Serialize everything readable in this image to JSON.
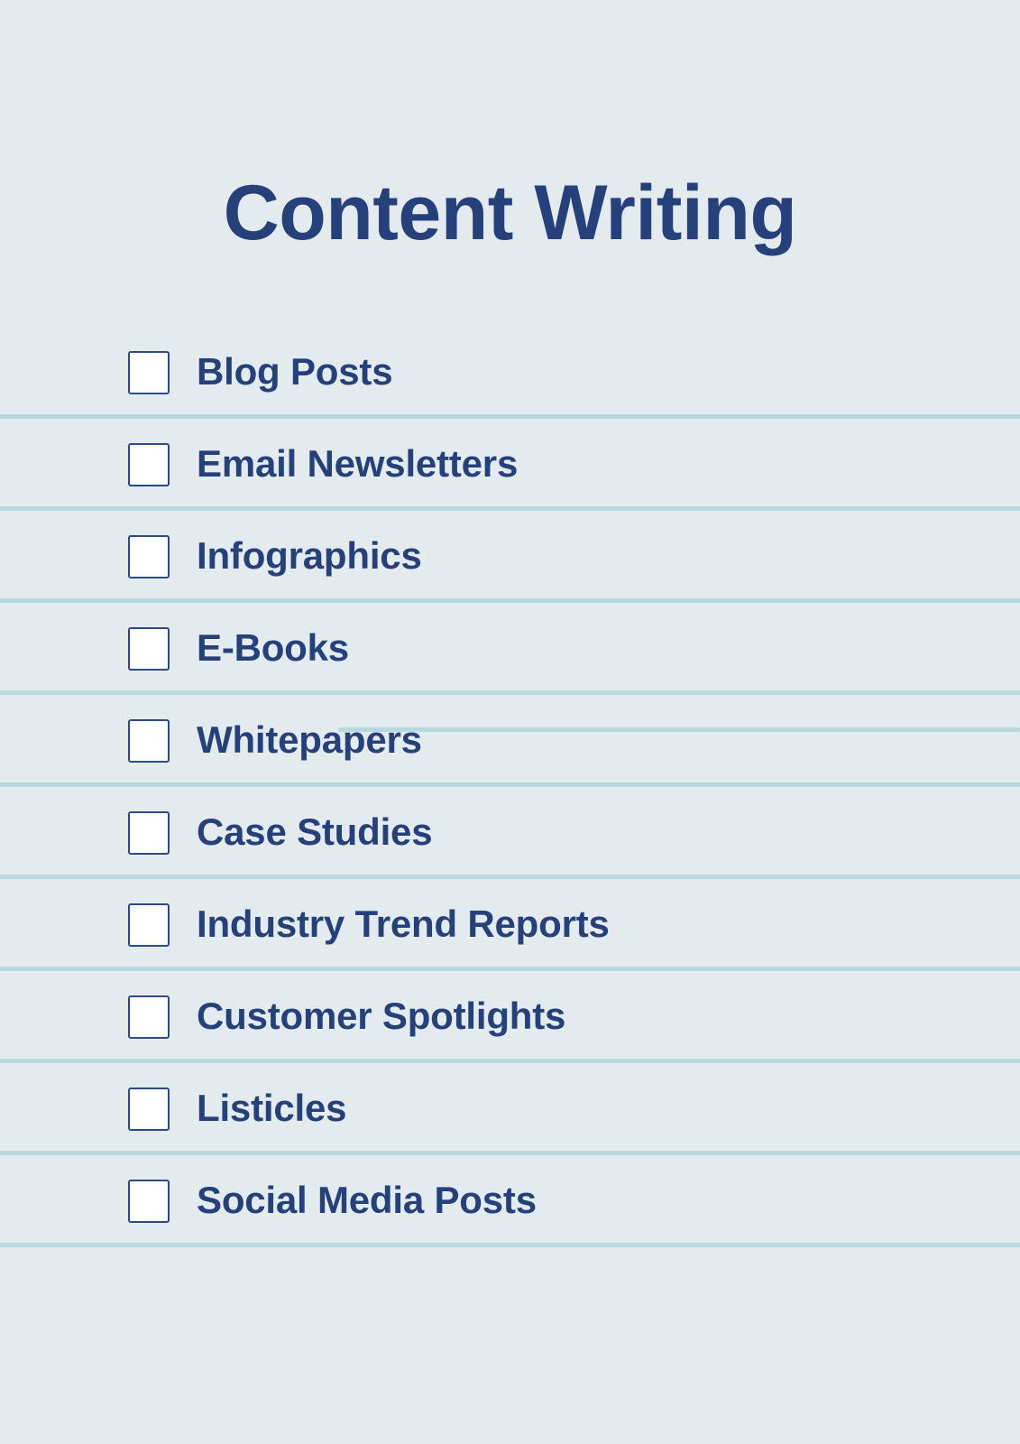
{
  "document": {
    "title": "Content Writing",
    "type": "checklist",
    "background_color": "#e4ebee",
    "accent_color": "#25407a",
    "divider_color": "#b9d8e0",
    "checkbox_fill_color": "#ffffff",
    "checkbox_border_color": "#2c4a8a"
  },
  "checklist": {
    "items": [
      {
        "label": "Blog Posts",
        "checked": false
      },
      {
        "label": "Email Newsletters",
        "checked": false
      },
      {
        "label": "Infographics",
        "checked": false
      },
      {
        "label": "E-Books",
        "checked": false
      },
      {
        "label": "Whitepapers",
        "checked": false
      },
      {
        "label": "Case Studies",
        "checked": false
      },
      {
        "label": "Industry Trend Reports",
        "checked": false
      },
      {
        "label": "Customer Spotlights",
        "checked": false
      },
      {
        "label": "Listicles",
        "checked": false
      },
      {
        "label": "Social Media Posts",
        "checked": false
      }
    ]
  }
}
